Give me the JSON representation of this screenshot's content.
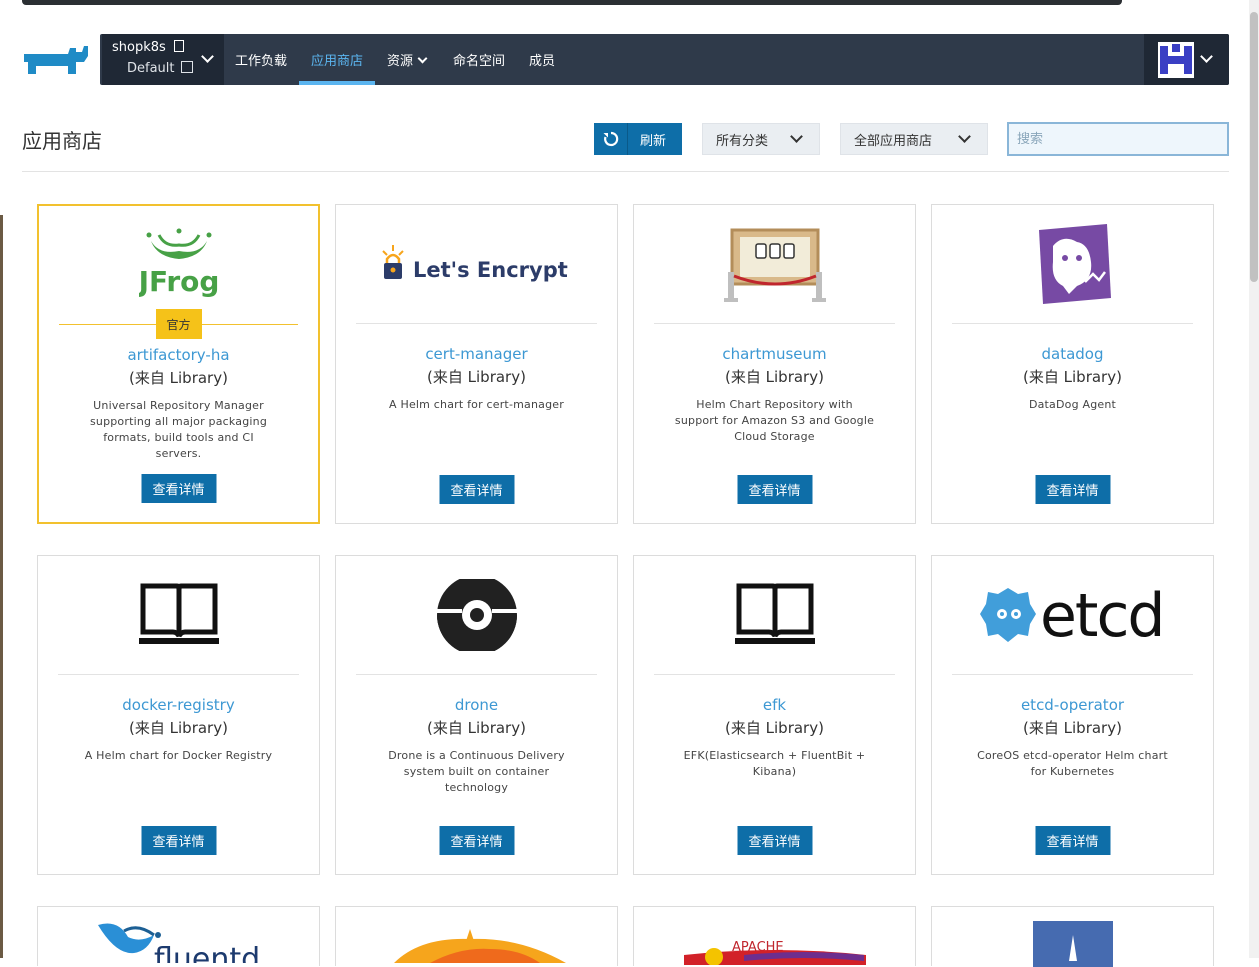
{
  "header": {
    "cluster_name": "shopk8s",
    "namespace": "Default",
    "nav": [
      {
        "label": "工作负载",
        "active": false
      },
      {
        "label": "应用商店",
        "active": true
      },
      {
        "label": "资源",
        "active": false,
        "dropdown": true
      },
      {
        "label": "命名空间",
        "active": false
      },
      {
        "label": "成员",
        "active": false
      }
    ]
  },
  "titlebar": {
    "title": "应用商店",
    "refresh_label": "刷新",
    "category_select": "所有分类",
    "catalog_select": "全部应用商店",
    "search_placeholder": "搜索"
  },
  "cards": [
    {
      "name": "artifactory-ha",
      "from": "(来自 Library)",
      "badge": "官方",
      "logo": "jfrog-logo",
      "logo_text": "JFrog",
      "desc": "Universal Repository Manager supporting all major packaging formats, build tools and CI servers.",
      "button": "查看详情"
    },
    {
      "name": "cert-manager",
      "from": "(来自 Library)",
      "logo": "lets-encrypt-logo",
      "logo_text": "Let's Encrypt",
      "desc": "A Helm chart for cert-manager",
      "button": "查看详情"
    },
    {
      "name": "chartmuseum",
      "from": "(来自 Library)",
      "logo": "chartmuseum-logo",
      "desc": "Helm Chart Repository with support for Amazon S3 and Google Cloud Storage",
      "button": "查看详情"
    },
    {
      "name": "datadog",
      "from": "(来自 Library)",
      "logo": "datadog-logo",
      "desc": "DataDog Agent",
      "button": "查看详情"
    },
    {
      "name": "docker-registry",
      "from": "(来自 Library)",
      "logo": "book-icon",
      "desc": "A Helm chart for Docker Registry",
      "button": "查看详情"
    },
    {
      "name": "drone",
      "from": "(来自 Library)",
      "logo": "drone-logo",
      "desc": "Drone is a Continuous Delivery system built on container technology",
      "button": "查看详情"
    },
    {
      "name": "efk",
      "from": "(来自 Library)",
      "logo": "book-icon",
      "desc": "EFK(Elasticsearch + FluentBit + Kibana)",
      "button": "查看详情"
    },
    {
      "name": "etcd-operator",
      "from": "(来自 Library)",
      "logo": "etcd-logo",
      "logo_text": "etcd",
      "desc": "CoreOS etcd-operator Helm chart for Kubernetes",
      "button": "查看详情"
    },
    {
      "logo": "fluentd-logo",
      "logo_text": "fluentd"
    },
    {
      "logo": "grafana-logo"
    },
    {
      "logo": "apache-logo",
      "logo_text": "APACHE"
    },
    {
      "logo": "helm-logo"
    }
  ],
  "colors": {
    "accent": "#0e6ea8",
    "link": "#3d98d3",
    "nav_bg": "#2f3a4a",
    "selected": "#f2c12e"
  }
}
